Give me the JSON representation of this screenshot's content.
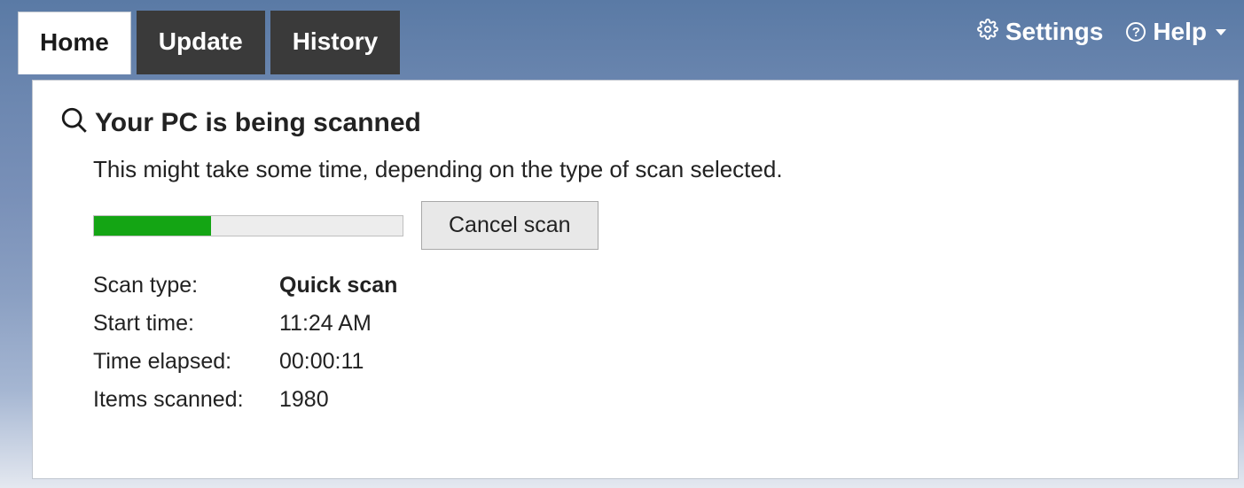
{
  "tabs": {
    "home": "Home",
    "update": "Update",
    "history": "History"
  },
  "header": {
    "settings": "Settings",
    "help": "Help"
  },
  "main": {
    "heading": "Your PC is being scanned",
    "subtext": "This might take some time, depending on the type of scan selected.",
    "cancel_label": "Cancel scan",
    "progress_percent": 38,
    "details": {
      "scan_type_label": "Scan type:",
      "scan_type_value": "Quick scan",
      "start_time_label": "Start time:",
      "start_time_value": "11:24 AM",
      "time_elapsed_label": "Time elapsed:",
      "time_elapsed_value": "00:00:11",
      "items_scanned_label": "Items scanned:",
      "items_scanned_value": "1980"
    }
  },
  "colors": {
    "progress_green": "#14a514",
    "header_gradient_top": "#5a7aa5"
  }
}
